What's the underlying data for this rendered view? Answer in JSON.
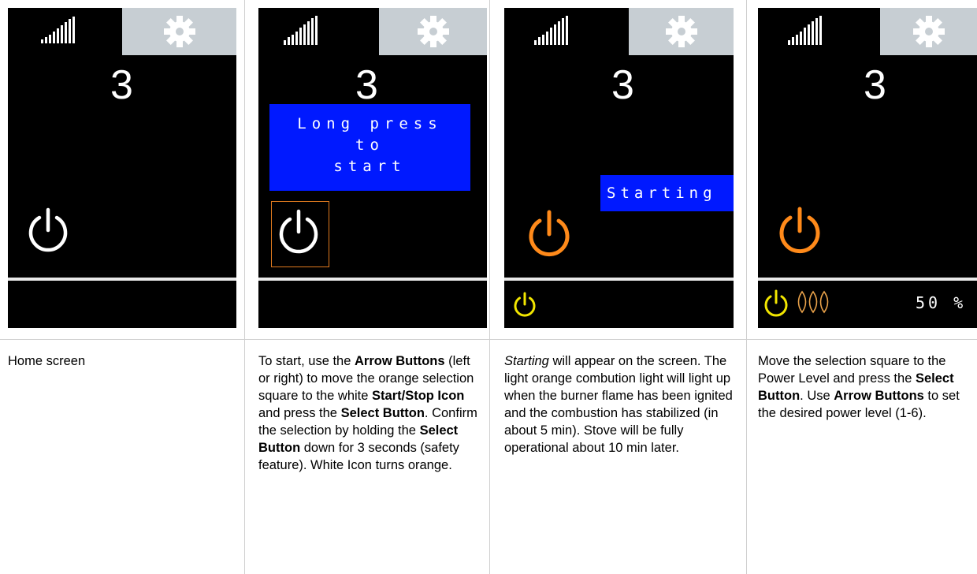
{
  "panels": [
    {
      "number": "3",
      "desc": [
        {
          "t": "Home screen",
          "s": "n"
        }
      ]
    },
    {
      "number": "3",
      "popup_lines": [
        "Long press",
        "to",
        "start"
      ],
      "desc": [
        {
          "t": "To start, use the ",
          "s": "n"
        },
        {
          "t": "Arrow Buttons",
          "s": "b"
        },
        {
          "t": " (left or right) to move the orange selection square to the white ",
          "s": "n"
        },
        {
          "t": "Start/Stop Icon",
          "s": "b"
        },
        {
          "t": " and press the ",
          "s": "n"
        },
        {
          "t": "Select Button",
          "s": "b"
        },
        {
          "t": ". Confirm the selection by holding the ",
          "s": "n"
        },
        {
          "t": "Select Button",
          "s": "b"
        },
        {
          "t": " down for 3 seconds (safety feature). White Icon turns orange.",
          "s": "n"
        }
      ]
    },
    {
      "number": "3",
      "status": "Starting",
      "desc": [
        {
          "t": "Starting",
          "s": "i"
        },
        {
          "t": " will appear on the screen. The light orange combution light will light up when the burner flame has been ignited and the combustion has stabilized (in about 5 min). Stove will be fully operational about 10 min later.",
          "s": "n"
        }
      ]
    },
    {
      "number": "3",
      "power_level": "50 %",
      "desc": [
        {
          "t": "Move the selection square to the Power Level and press the ",
          "s": "n"
        },
        {
          "t": "Select Button",
          "s": "b"
        },
        {
          "t": ". Use ",
          "s": "n"
        },
        {
          "t": "Arrow Buttons",
          "s": "b"
        },
        {
          "t": " to set the desired power level (1-6).",
          "s": "n"
        }
      ]
    }
  ],
  "colors": {
    "screen_bg": "#000000",
    "gear_box": "#c7ced3",
    "popup_blue": "#0019ff",
    "power_white": "#ffffff",
    "power_orange": "#ff8a1a",
    "status_yellow": "#f2e600",
    "flame_orange": "#e9a24a",
    "selection_border": "#e07a1f"
  },
  "icons": [
    "signal-strength-icon",
    "gear-icon",
    "power-icon",
    "flame-icon"
  ]
}
